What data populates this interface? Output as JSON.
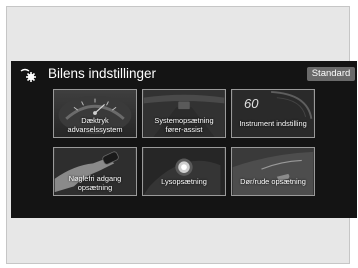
{
  "header": {
    "title": "Bilens indstillinger",
    "standard_label": "Standard"
  },
  "tiles": [
    {
      "line1": "Dæktryk",
      "line2": "advarselssystem"
    },
    {
      "line1": "Systemopsætning",
      "line2": "fører-assist"
    },
    {
      "line1": "Instrument indstilling",
      "readout": "60"
    },
    {
      "line1": "Nøglefri adgang",
      "line2": "opsætning"
    },
    {
      "line1": "Lysopsætning"
    },
    {
      "line1": "Dør/rude opsætning"
    }
  ],
  "icons": {
    "settings": "settings-gear-icon"
  },
  "colors": {
    "screen_bg": "#141414",
    "tile_border": "#9a9a9a",
    "standard_button": "#6a6a6a"
  }
}
